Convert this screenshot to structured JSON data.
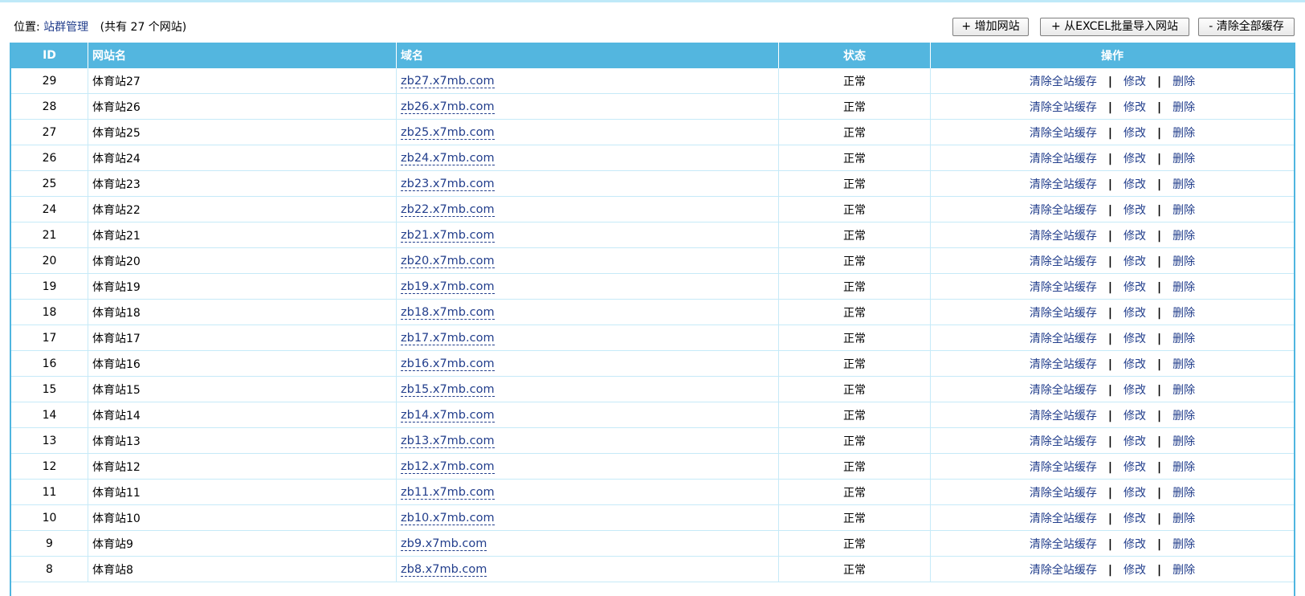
{
  "breadcrumb": {
    "prefix": "位置:",
    "link": "站群管理",
    "count_text": "(共有 27 个网站)"
  },
  "toolbar": {
    "add_label": "+ 增加网站",
    "import_label": "+ 从EXCEL批量导入网站",
    "clear_label": "- 清除全部缓存"
  },
  "colors": {
    "header_bg": "#53b6df",
    "link": "#223e8c",
    "row_border": "#c6eaf8"
  },
  "table": {
    "headers": {
      "id": "ID",
      "name": "网站名",
      "domain": "域名",
      "status": "状态",
      "ops": "操作"
    },
    "ops": {
      "clear_cache": "清除全站缓存",
      "edit": "修改",
      "delete": "删除",
      "sep": "|"
    },
    "rows": [
      {
        "id": "29",
        "name": "体育站27",
        "domain": "zb27.x7mb.com",
        "status": "正常"
      },
      {
        "id": "28",
        "name": "体育站26",
        "domain": "zb26.x7mb.com",
        "status": "正常"
      },
      {
        "id": "27",
        "name": "体育站25",
        "domain": "zb25.x7mb.com",
        "status": "正常"
      },
      {
        "id": "26",
        "name": "体育站24",
        "domain": "zb24.x7mb.com",
        "status": "正常"
      },
      {
        "id": "25",
        "name": "体育站23",
        "domain": "zb23.x7mb.com",
        "status": "正常"
      },
      {
        "id": "24",
        "name": "体育站22",
        "domain": "zb22.x7mb.com",
        "status": "正常"
      },
      {
        "id": "21",
        "name": "体育站21",
        "domain": "zb21.x7mb.com",
        "status": "正常"
      },
      {
        "id": "20",
        "name": "体育站20",
        "domain": "zb20.x7mb.com",
        "status": "正常"
      },
      {
        "id": "19",
        "name": "体育站19",
        "domain": "zb19.x7mb.com",
        "status": "正常"
      },
      {
        "id": "18",
        "name": "体育站18",
        "domain": "zb18.x7mb.com",
        "status": "正常"
      },
      {
        "id": "17",
        "name": "体育站17",
        "domain": "zb17.x7mb.com",
        "status": "正常"
      },
      {
        "id": "16",
        "name": "体育站16",
        "domain": "zb16.x7mb.com",
        "status": "正常"
      },
      {
        "id": "15",
        "name": "体育站15",
        "domain": "zb15.x7mb.com",
        "status": "正常"
      },
      {
        "id": "14",
        "name": "体育站14",
        "domain": "zb14.x7mb.com",
        "status": "正常"
      },
      {
        "id": "13",
        "name": "体育站13",
        "domain": "zb13.x7mb.com",
        "status": "正常"
      },
      {
        "id": "12",
        "name": "体育站12",
        "domain": "zb12.x7mb.com",
        "status": "正常"
      },
      {
        "id": "11",
        "name": "体育站11",
        "domain": "zb11.x7mb.com",
        "status": "正常"
      },
      {
        "id": "10",
        "name": "体育站10",
        "domain": "zb10.x7mb.com",
        "status": "正常"
      },
      {
        "id": "9",
        "name": "体育站9",
        "domain": "zb9.x7mb.com",
        "status": "正常"
      },
      {
        "id": "8",
        "name": "体育站8",
        "domain": "zb8.x7mb.com",
        "status": "正常"
      }
    ]
  }
}
